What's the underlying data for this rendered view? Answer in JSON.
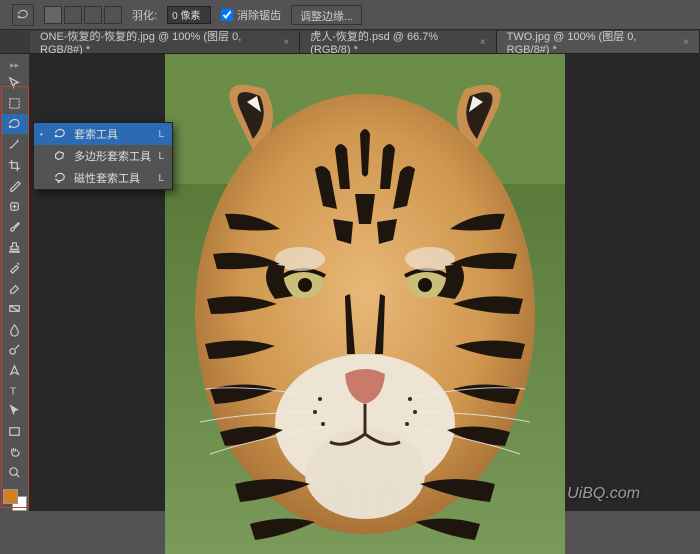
{
  "options": {
    "feather_label": "羽化:",
    "feather_value": "0 像素",
    "antialias_label": "消除锯齿",
    "antialias_checked": true,
    "refine_label": "调整边缘..."
  },
  "tabs": [
    {
      "label": "ONE-恢复的-恢复的.jpg @ 100% (图层 0, RGB/8#) *",
      "active": false
    },
    {
      "label": "虎人-恢复的.psd @ 66.7%(RGB/8) *",
      "active": false
    },
    {
      "label": "TWO.jpg @ 100% (图层 0, RGB/8#) *",
      "active": true
    }
  ],
  "flyout": {
    "items": [
      {
        "label": "套索工具",
        "key": "L",
        "selected": true,
        "icon": "lasso"
      },
      {
        "label": "多边形套索工具",
        "key": "L",
        "selected": false,
        "icon": "poly-lasso"
      },
      {
        "label": "磁性套索工具",
        "key": "L",
        "selected": false,
        "icon": "mag-lasso"
      }
    ]
  },
  "tools": [
    "move",
    "marquee",
    "lasso",
    "wand",
    "crop",
    "eyedropper",
    "healing",
    "brush",
    "stamp",
    "history",
    "eraser",
    "gradient",
    "blur",
    "dodge",
    "pen",
    "type",
    "path-select",
    "rectangle",
    "hand",
    "zoom"
  ],
  "colors": {
    "foreground": "#d48020",
    "background": "#ffffff"
  },
  "watermark": "UiBQ.com"
}
